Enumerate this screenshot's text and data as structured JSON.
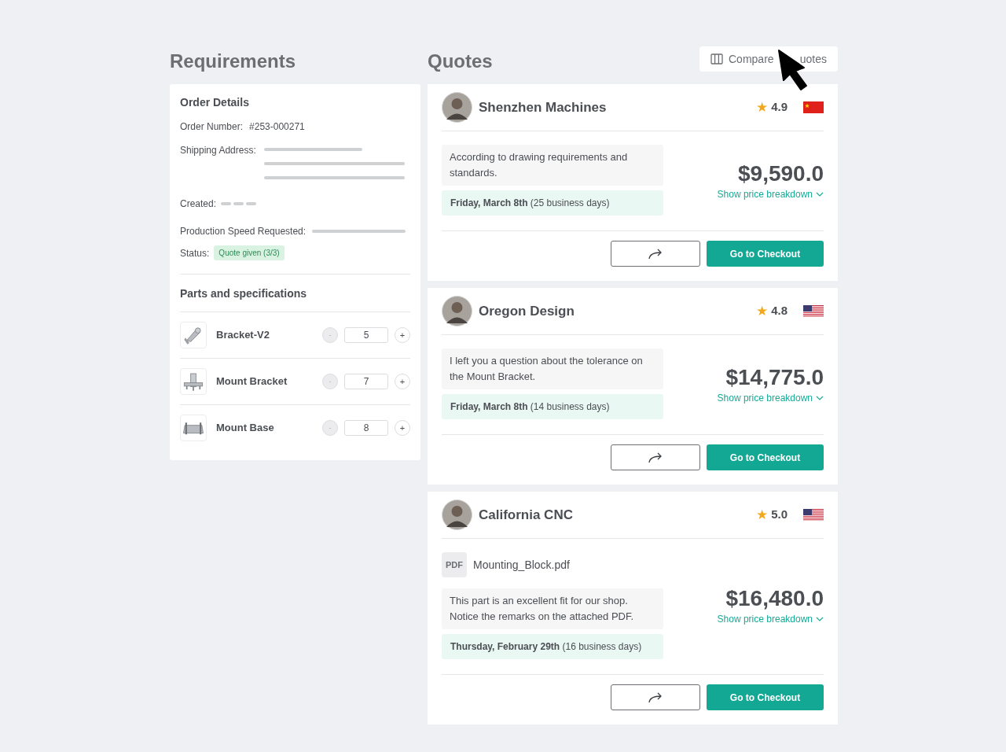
{
  "requirements": {
    "title": "Requirements",
    "order_details": {
      "title": "Order Details",
      "order_number_label": "Order Number:",
      "order_number": "#253-000271",
      "shipping_label": "Shipping Address:",
      "created_label": "Created:",
      "speed_label": "Production Speed Requested:",
      "status_label": "Status:",
      "status": "Quote given (3/3)"
    },
    "parts": {
      "title": "Parts and specifications",
      "items": [
        {
          "kind": "bracket",
          "name": "Bracket-V2",
          "decrement": "-",
          "quantity": "5",
          "increment": "+",
          "decrement_disabled": true
        },
        {
          "kind": "mount",
          "name": "Mount Bracket",
          "decrement": "-",
          "quantity": "7",
          "increment": "+",
          "decrement_disabled": true
        },
        {
          "kind": "base",
          "name": "Mount Base",
          "decrement": "-",
          "quantity": "8",
          "increment": "+",
          "decrement_disabled": true
        }
      ]
    }
  },
  "quotes": {
    "title": "Quotes",
    "compare_button": {
      "label_parts": [
        "Compare",
        "uotes"
      ]
    },
    "items": [
      {
        "supplier": "Shenzhen Machines",
        "star": "★",
        "rating": "4.9",
        "kind": "cn-flag",
        "message": "According to drawing requirements and standards.",
        "delivery": "**Friday, March 8th** (25 business days)",
        "price": "$9,590.0",
        "breakdown": "Show price breakdown",
        "checkout": "Go to Checkout"
      },
      {
        "supplier": "Oregon Design",
        "star": "★",
        "rating": "4.8",
        "kind": "us-flag",
        "message": "I left you a question about the tolerance on the Mount Bracket.",
        "delivery": "**Friday, March 8th** (14 business days)",
        "price": "$14,775.0",
        "breakdown": "Show price breakdown",
        "checkout": "Go to Checkout"
      },
      {
        "supplier": "California CNC",
        "star": "★",
        "rating": "5.0",
        "kind": "us-flag",
        "attachment": {
          "type": "PDF",
          "name": "Mounting_Block.pdf"
        },
        "message": "This part is an excellent fit for our shop. Notice the remarks on the attached PDF.",
        "delivery": "**Thursday, February 29th** (16 business days)",
        "price": "$16,480.0",
        "breakdown": "Show price breakdown",
        "checkout": "Go to Checkout"
      }
    ]
  }
}
